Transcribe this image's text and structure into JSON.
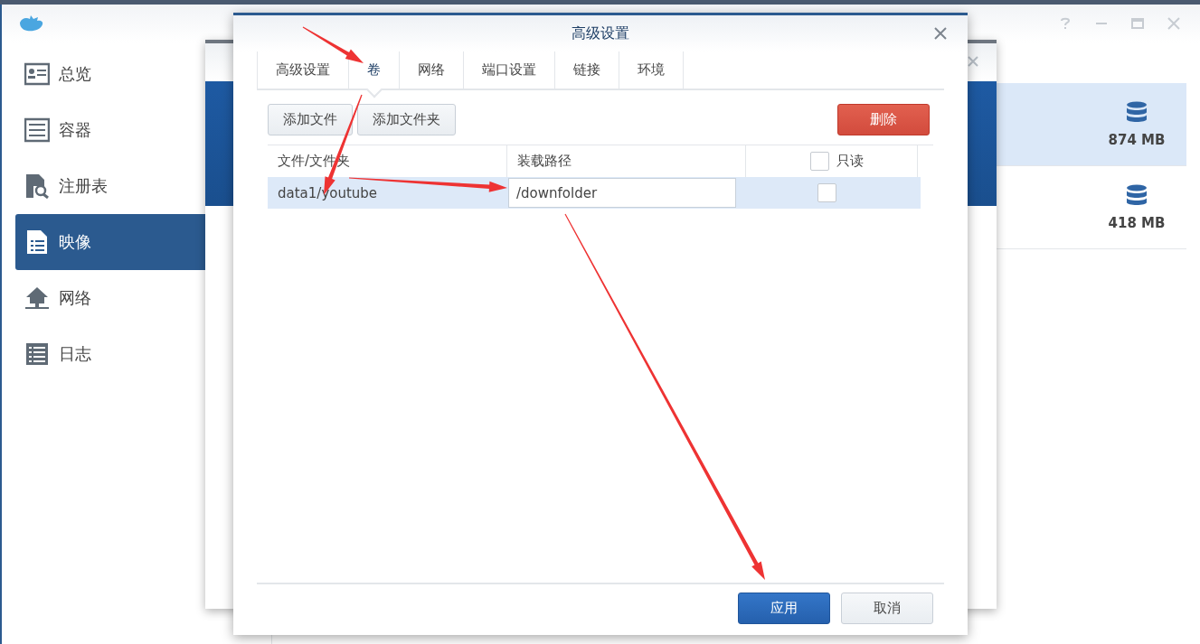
{
  "sidebar": {
    "items": [
      {
        "label": "总览",
        "selected": false
      },
      {
        "label": "容器",
        "selected": false
      },
      {
        "label": "注册表",
        "selected": false
      },
      {
        "label": "映像",
        "selected": true
      },
      {
        "label": "网络",
        "selected": false
      },
      {
        "label": "日志",
        "selected": false
      }
    ]
  },
  "images": [
    {
      "size": "874 MB",
      "selected": true
    },
    {
      "size": "418 MB",
      "selected": false
    }
  ],
  "dialog": {
    "title": "高级设置",
    "tabs": [
      {
        "label": "高级设置",
        "selected": false
      },
      {
        "label": "卷",
        "selected": true
      },
      {
        "label": "网络",
        "selected": false
      },
      {
        "label": "端口设置",
        "selected": false
      },
      {
        "label": "链接",
        "selected": false
      },
      {
        "label": "环境",
        "selected": false
      }
    ],
    "toolbar": [
      {
        "label": "添加文件",
        "kind": "plain"
      },
      {
        "label": "添加文件夹",
        "kind": "plain"
      },
      {
        "label": "删除",
        "kind": "danger"
      }
    ],
    "table": {
      "columns": [
        {
          "label": "文件/文件夹",
          "kind": "text"
        },
        {
          "label": "装载路径",
          "kind": "text"
        },
        {
          "label": "只读",
          "kind": "checkbox",
          "checked": false
        }
      ],
      "rows": [
        {
          "file": "data1/youtube",
          "mount_path": "/downfolder",
          "read_only": false,
          "selected": true
        }
      ]
    },
    "footer_buttons": [
      {
        "label": "应用",
        "kind": "primary"
      },
      {
        "label": "取消",
        "kind": "plain"
      }
    ]
  }
}
